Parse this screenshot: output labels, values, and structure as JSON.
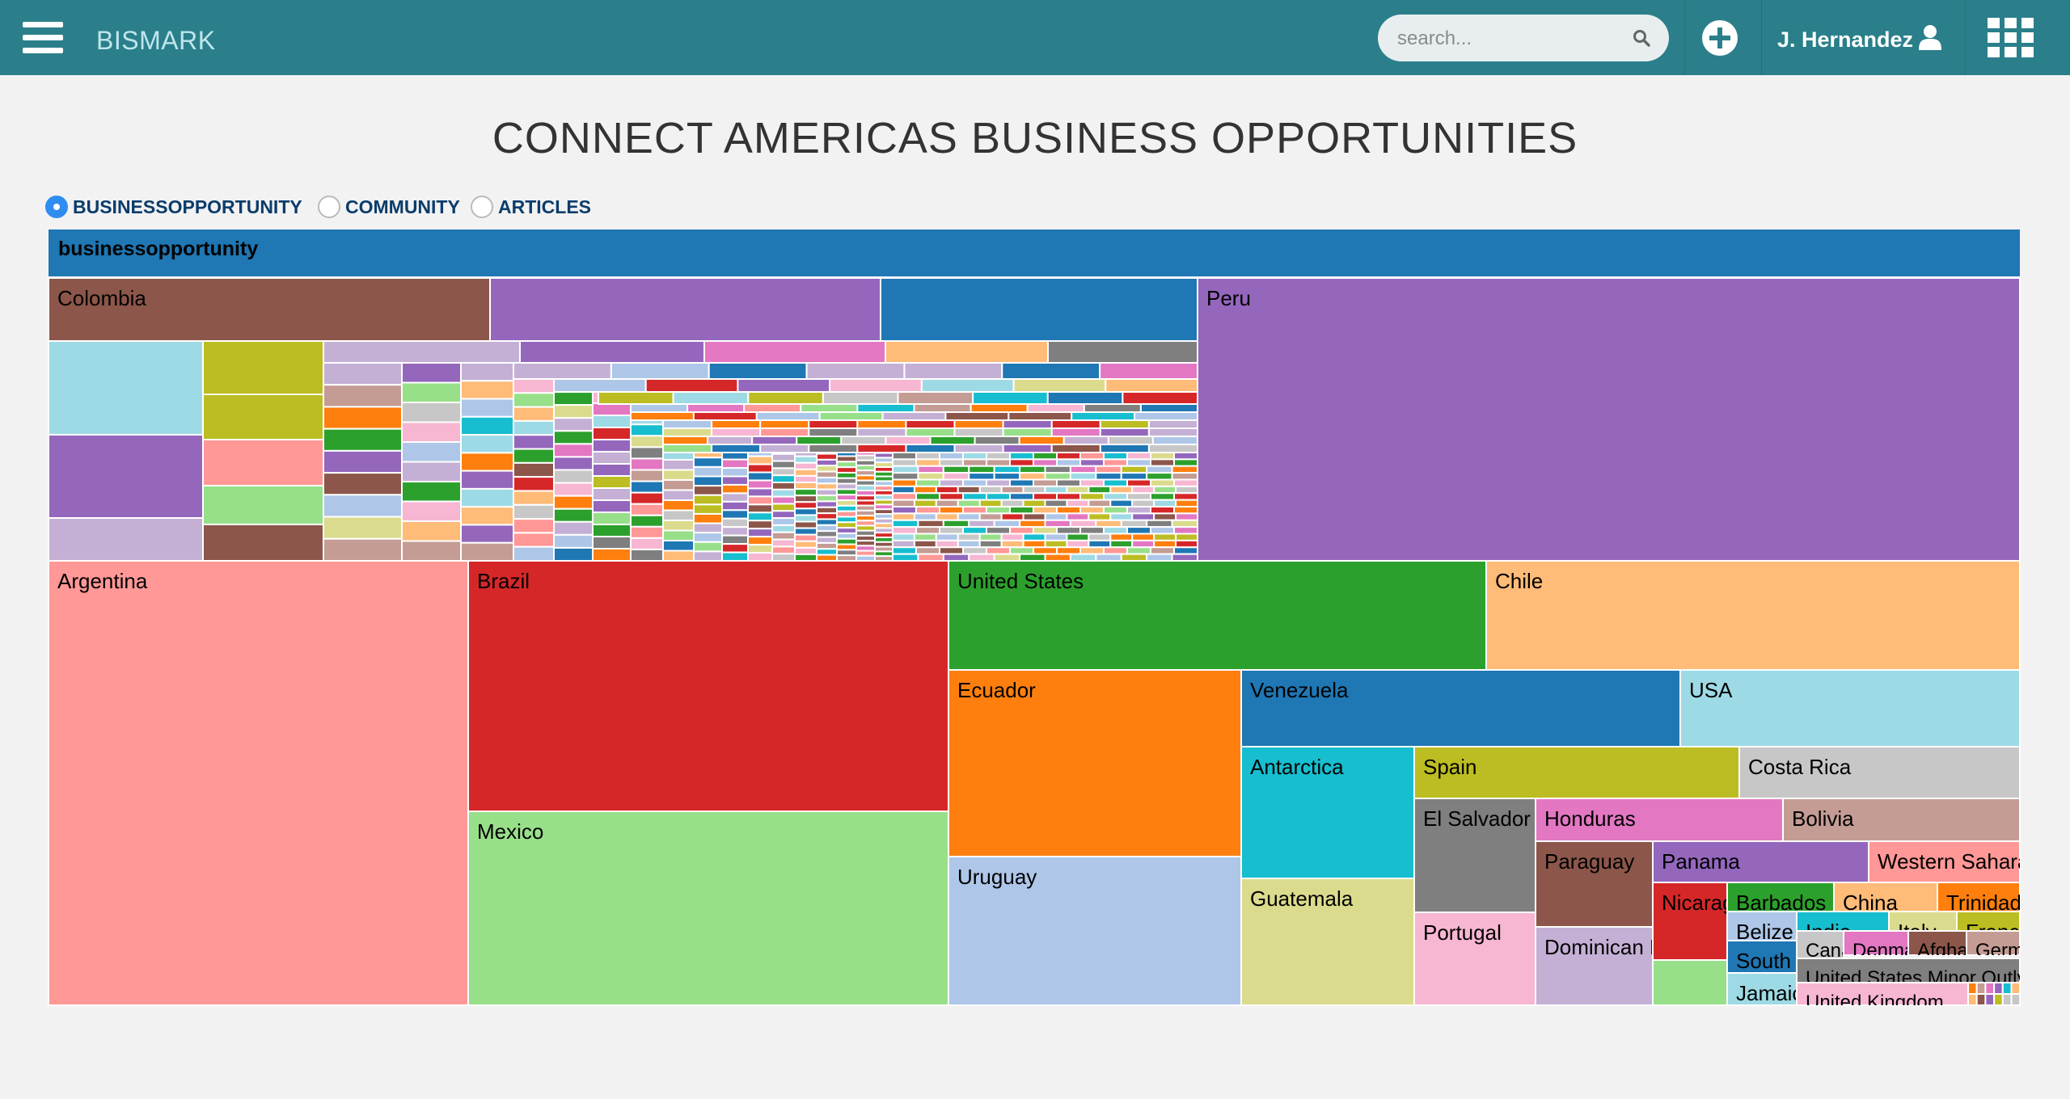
{
  "app": {
    "brand": "BISMARK"
  },
  "search": {
    "placeholder": "search..."
  },
  "user": {
    "name": "J. Hernandez"
  },
  "page": {
    "title": "CONNECT AMERICAS BUSINESS OPPORTUNITIES"
  },
  "radios": {
    "options": [
      {
        "label": "BUSINESSOPPORTUNITY",
        "checked": true
      },
      {
        "label": "COMMUNITY",
        "checked": false
      },
      {
        "label": "ARTICLES",
        "checked": false
      }
    ]
  },
  "colors": {
    "header": "#2a7f8a",
    "accent": "#2f8cf0"
  },
  "treemap": {
    "root_label": "businessopportunity",
    "countries": [
      {
        "name": "Peru",
        "color": "#9467bd"
      },
      {
        "name": "Colombia",
        "color": "#8c564b"
      },
      {
        "name": "",
        "color": "#9467bd"
      },
      {
        "name": "",
        "color": "#1f77b4"
      },
      {
        "name": "Argentina",
        "color": "#ff9896"
      },
      {
        "name": "Brazil",
        "color": "#d62728"
      },
      {
        "name": "Mexico",
        "color": "#98df8a"
      },
      {
        "name": "United States",
        "color": "#2ca02c"
      },
      {
        "name": "Chile",
        "color": "#ffbb78"
      },
      {
        "name": "Ecuador",
        "color": "#ff7f0e"
      },
      {
        "name": "Uruguay",
        "color": "#aec7e8"
      },
      {
        "name": "Venezuela",
        "color": "#1f77b4"
      },
      {
        "name": "USA",
        "color": "#9edae5"
      },
      {
        "name": "Antarctica",
        "color": "#17becf"
      },
      {
        "name": "Guatemala",
        "color": "#dbdb8d"
      },
      {
        "name": "Spain",
        "color": "#bcbd22"
      },
      {
        "name": "Costa Rica",
        "color": "#c7c7c7"
      },
      {
        "name": "El Salvador",
        "color": "#7f7f7f"
      },
      {
        "name": "Portugal",
        "color": "#f7b6d2"
      },
      {
        "name": "Honduras",
        "color": "#e377c2"
      },
      {
        "name": "Bolivia",
        "color": "#c49c94"
      },
      {
        "name": "Paraguay",
        "color": "#8c564b"
      },
      {
        "name": "Dominican Republic",
        "color": "#c5b0d5"
      },
      {
        "name": "Panama",
        "color": "#9467bd"
      },
      {
        "name": "Western Sahara",
        "color": "#ff9896"
      },
      {
        "name": "Nicaragua",
        "color": "#d62728"
      },
      {
        "name": "",
        "color": "#98df8a"
      },
      {
        "name": "Barbados",
        "color": "#2ca02c"
      },
      {
        "name": "China",
        "color": "#ffbb78"
      },
      {
        "name": "Trinidad",
        "color": "#ff7f0e"
      },
      {
        "name": "Belize",
        "color": "#aec7e8"
      },
      {
        "name": "India",
        "color": "#17becf"
      },
      {
        "name": "Italy",
        "color": "#dbdb8d"
      },
      {
        "name": "France",
        "color": "#bcbd22"
      },
      {
        "name": "South Korea",
        "color": "#1f77b4"
      },
      {
        "name": "Jamaica",
        "color": "#9edae5"
      },
      {
        "name": "Canada",
        "color": "#c7c7c7"
      },
      {
        "name": "Denmark",
        "color": "#e377c2"
      },
      {
        "name": "Afghanistan",
        "color": "#8c564b"
      },
      {
        "name": "Germany",
        "color": "#c49c94"
      },
      {
        "name": "United States Minor Outlying Islands",
        "color": "#7f7f7f"
      },
      {
        "name": "United Kingdom",
        "color": "#f7b6d2"
      }
    ]
  }
}
